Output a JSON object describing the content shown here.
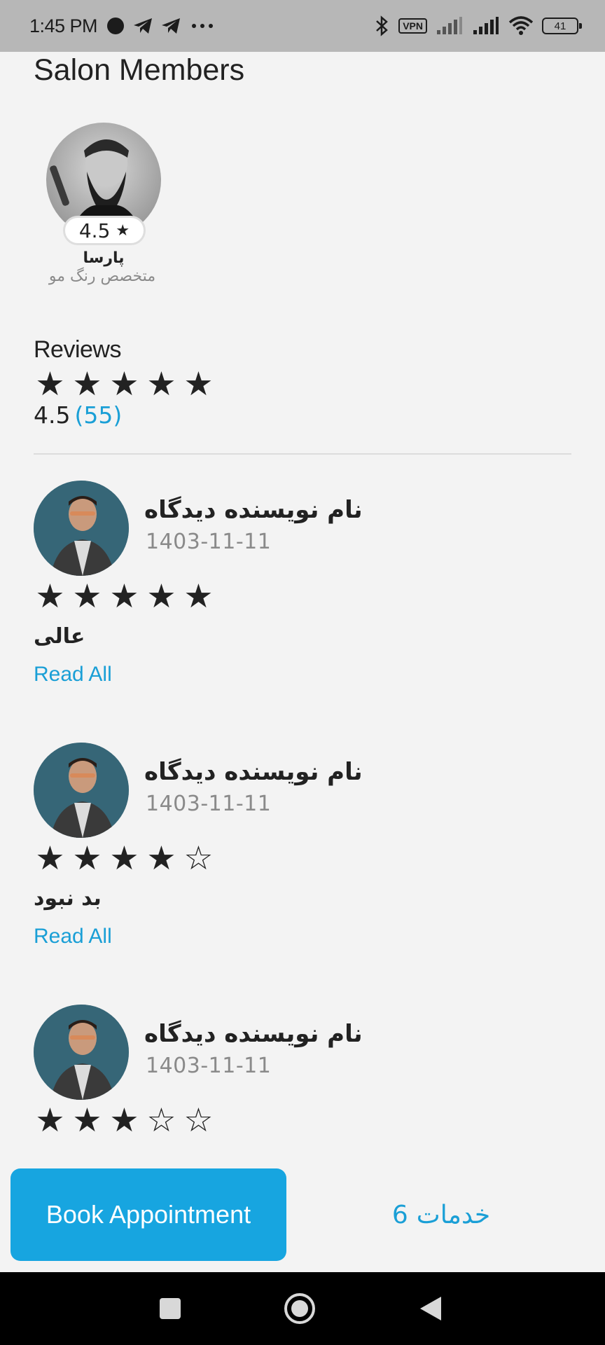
{
  "status_bar": {
    "time": "1:45 PM",
    "vpn": "VPN",
    "battery": "41"
  },
  "page": {
    "title": "Salon Members"
  },
  "member": {
    "rating": "4.5",
    "name": "پارسا",
    "role": "متخصص رنگ مو"
  },
  "reviews": {
    "title": "Reviews",
    "average": "4.5",
    "count": "(55)",
    "average_stars": 5,
    "items": [
      {
        "author": "نام نویسنده دیدگاه",
        "date": "1403-11-11",
        "rating": 5,
        "text": "عالی",
        "read_all": "Read All"
      },
      {
        "author": "نام نویسنده دیدگاه",
        "date": "1403-11-11",
        "rating": 4,
        "text": "بد نبود",
        "read_all": "Read All"
      },
      {
        "author": "نام نویسنده دیدگاه",
        "date": "1403-11-11",
        "rating": 3
      }
    ]
  },
  "actions": {
    "book": "Book Appointment",
    "services_label": "خدمات",
    "services_count": "6"
  },
  "colors": {
    "accent": "#17a5e0",
    "link": "#1a9fd6"
  }
}
